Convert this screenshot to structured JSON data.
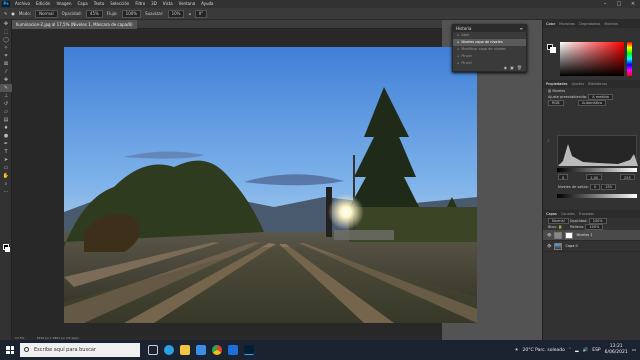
{
  "menubar": {
    "items": [
      "Archivo",
      "Edición",
      "Imagen",
      "Capa",
      "Texto",
      "Selección",
      "Filtro",
      "3D",
      "Vista",
      "Ventana",
      "Ayuda"
    ]
  },
  "options": {
    "modo_label": "Modo:",
    "modo": "Normal",
    "opacidad_label": "Opacidad:",
    "opacidad": "45%",
    "flujo_label": "Flujo:",
    "flujo": "100%",
    "suavizar_label": "Suavizar:",
    "suavizar": "10%",
    "angle": "0°"
  },
  "document": {
    "tab": "Iluminacion-2.jpg al 17,5% (Niveles 1, Máscara de capa/8)",
    "status_zoom": "17,5%",
    "status_size": "3919 px x 2801 px (72 ppp)"
  },
  "history": {
    "title": "Historia",
    "items": [
      "Abrir",
      "Niveles capa de niveles",
      "Modificar capa de niveles",
      "Pincel",
      "Pincel"
    ],
    "selected": 1
  },
  "color_panel": {
    "tabs": [
      "Color",
      "Muestras",
      "Degradados",
      "Motivos"
    ]
  },
  "properties": {
    "tabs": [
      "Propiedades",
      "Ajustes",
      "Bibliotecas"
    ],
    "title": "Niveles",
    "preset_label": "Ajuste preestablecido:",
    "preset": "A medida",
    "channel": "RGB",
    "auto": "Automático",
    "input_values": [
      "0",
      "1,00",
      "255"
    ],
    "output_label": "Niveles de salida:",
    "output_values": [
      "0",
      "255"
    ]
  },
  "layers": {
    "tabs": [
      "Capas",
      "Canales",
      "Trazados"
    ],
    "blend": "Normal",
    "opacity_label": "Opacidad:",
    "opacity": "100%",
    "fill_label": "Relleno:",
    "fill": "100%",
    "lock_label": "Bloq:",
    "items": [
      "Niveles 1",
      "Capa 0"
    ]
  },
  "taskbar": {
    "search_placeholder": "Escribe aquí para buscar",
    "weather": "20°C Parc. soleado",
    "lang": "ESP",
    "time": "13:21",
    "date": "6/06/2021"
  }
}
